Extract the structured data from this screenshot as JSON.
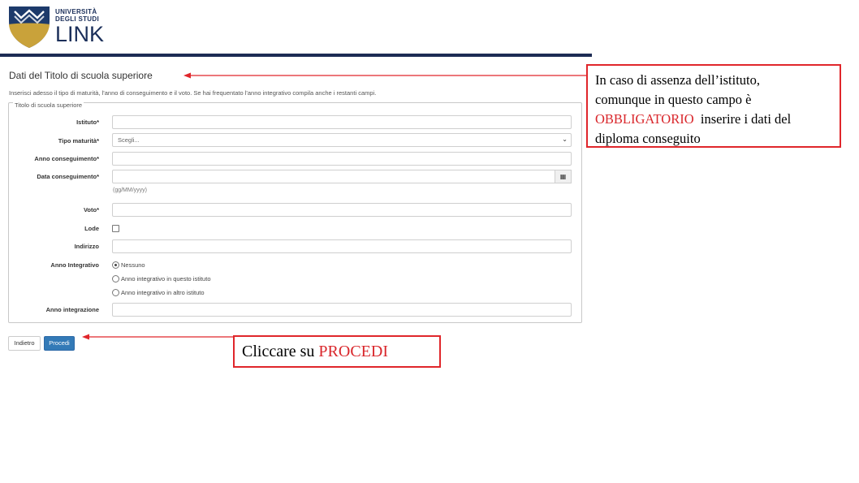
{
  "logo": {
    "line1": "UNIVERSITÀ",
    "line2": "DEGLI STUDI",
    "line3": "LINK"
  },
  "form": {
    "title": "Dati del Titolo di scuola superiore",
    "intro": "Inserisci adesso il tipo di maturità, l'anno di conseguimento e il voto. Se hai frequentato l'anno integrativo compila anche i restanti campi.",
    "legend": "Titolo di scuola superiore",
    "fields": {
      "istituto": "Istituto*",
      "tipo_maturita": "Tipo maturità*",
      "tipo_maturita_value": "Scegli...",
      "anno_conseguimento": "Anno conseguimento*",
      "data_conseguimento": "Data conseguimento*",
      "data_hint": "(gg/MM/yyyy)",
      "voto": "Voto*",
      "lode": "Lode",
      "indirizzo": "Indirizzo",
      "anno_integrativo": "Anno Integrativo",
      "anno_integrazione": "Anno integrazione"
    },
    "radio_options": [
      {
        "label": "Nessuno",
        "checked": true
      },
      {
        "label": "Anno integrativo in questo istituto",
        "checked": false
      },
      {
        "label": "Anno integrativo in altro istituto",
        "checked": false
      }
    ],
    "buttons": {
      "back": "Indietro",
      "next": "Procedi"
    }
  },
  "callouts": {
    "istituto": {
      "line1": "In caso di assenza dell’istituto,",
      "line2": "comunque  in questo campo è",
      "highlight": "OBBLIGATORIO",
      "line3_rest": "  inserire i dati del",
      "line4": "diploma conseguito"
    },
    "procedi": {
      "prefix": "Cliccare su ",
      "highlight": "PROCEDI"
    }
  },
  "colors": {
    "header_bar": "#1d2c54",
    "primary_button": "#337ab7",
    "callout_red": "#e0262b",
    "logo_gold": "#c9a23a"
  }
}
